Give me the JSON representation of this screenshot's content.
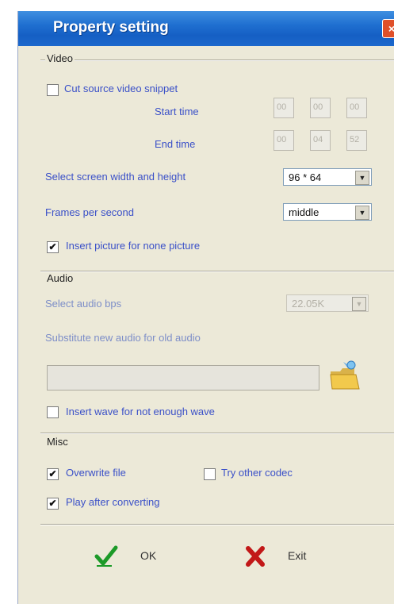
{
  "window": {
    "title": "Property setting",
    "close_symbol": "×"
  },
  "video": {
    "section_label": "Video",
    "cut_source": {
      "label": "Cut source video snippet",
      "checked": false
    },
    "start_time": {
      "label": "Start time",
      "h": "00",
      "m": "00",
      "s": "00"
    },
    "end_time": {
      "label": "End time",
      "h": "00",
      "m": "04",
      "s": "52"
    },
    "screen_size": {
      "label": "Select screen width and height",
      "value": "96 * 64"
    },
    "fps": {
      "label": "Frames per second",
      "value": "middle"
    },
    "insert_picture": {
      "label": "Insert picture for none picture",
      "checked": true
    }
  },
  "audio": {
    "section_label": "Audio",
    "bps": {
      "label": "Select audio bps",
      "value": "22.05K"
    },
    "substitute": {
      "label": "Substitute new audio for old audio",
      "path_value": ""
    },
    "insert_wave": {
      "label": "Insert wave for not enough wave",
      "checked": false
    }
  },
  "misc": {
    "section_label": "Misc",
    "overwrite": {
      "label": "Overwrite file",
      "checked": true
    },
    "try_codec": {
      "label": "Try other codec",
      "checked": false
    },
    "play_after": {
      "label": "Play after converting",
      "checked": true
    }
  },
  "buttons": {
    "ok_label": "OK",
    "exit_label": "Exit"
  },
  "check_mark": "✔",
  "dropdown_arrow": "▼",
  "icons": {
    "ok": "green-checkmark-icon",
    "exit": "red-x-icon",
    "browse": "open-folder-icon"
  },
  "colors": {
    "title_bar": "#1f6fd0",
    "label_text": "#3a50c8",
    "dialog_bg": "#ece9d8"
  }
}
